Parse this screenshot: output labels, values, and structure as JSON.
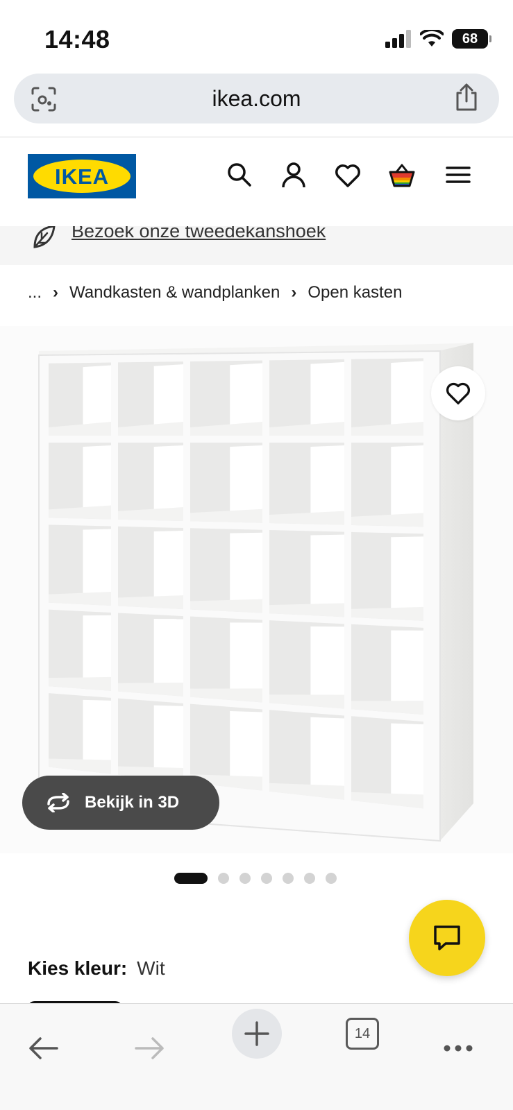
{
  "status_bar": {
    "time": "14:48",
    "battery": "68"
  },
  "browser": {
    "url": "ikea.com",
    "tab_count": "14"
  },
  "header": {
    "logo_text": "IKEA"
  },
  "banner": {
    "link_text": "Bezoek onze tweedekanshoek"
  },
  "breadcrumb": {
    "ellipsis": "...",
    "items": [
      "Wandkasten & wandplanken",
      "Open kasten"
    ]
  },
  "gallery": {
    "view_3d_label": "Bekijk in 3D",
    "total_images": 7,
    "active_index": 0
  },
  "product": {
    "color_label": "Kies kleur:",
    "color_value": "Wit"
  },
  "colors": {
    "ikea_blue": "#0058a3",
    "ikea_yellow": "#ffdb00",
    "chat_yellow": "#f6d51c"
  }
}
